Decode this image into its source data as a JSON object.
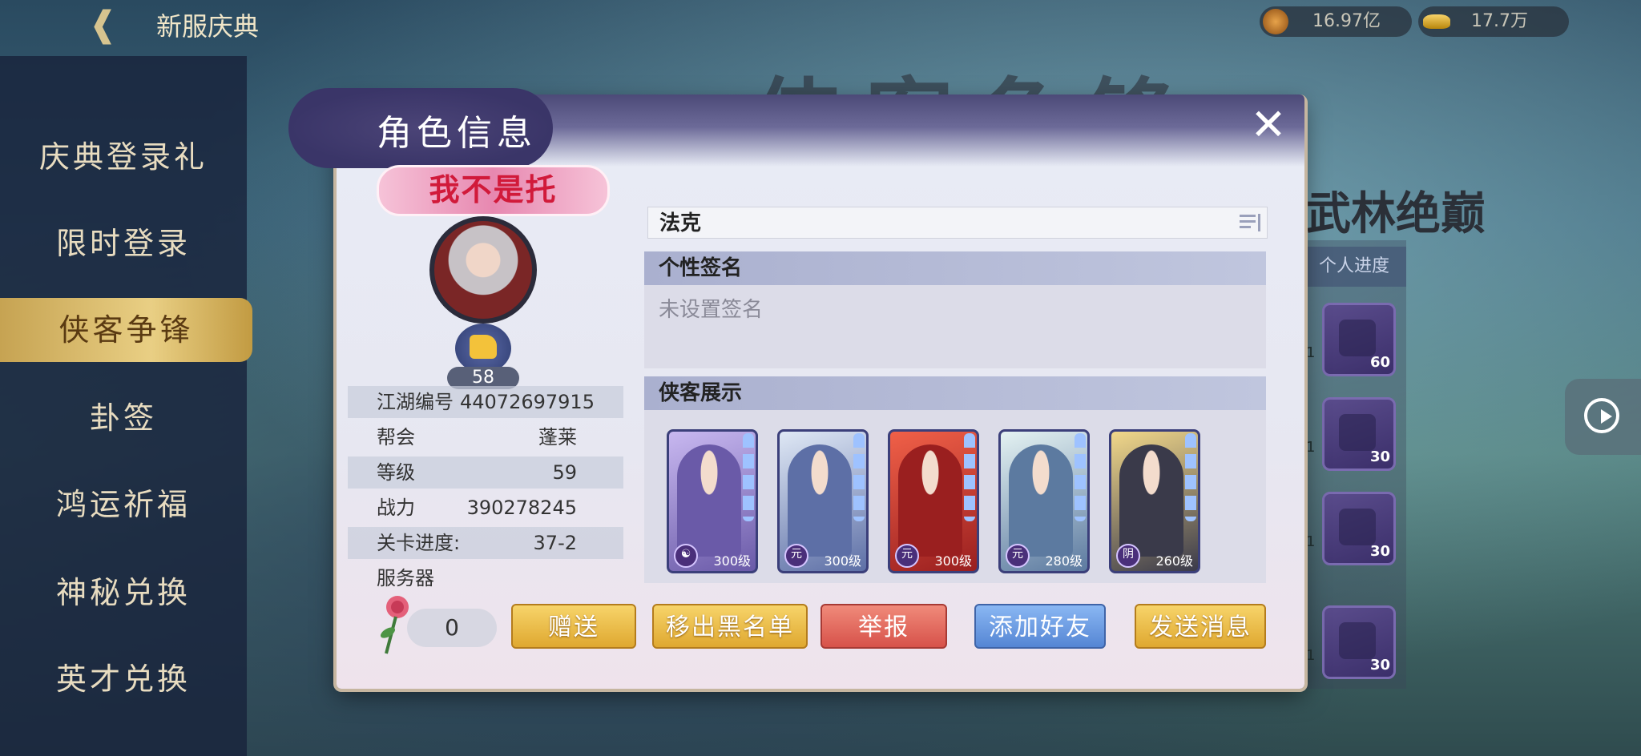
{
  "top_bar": {
    "back_icon": "back-arrow-icon",
    "title": "新服庆典",
    "resources": [
      {
        "icon": "coin-icon",
        "value": "16.97亿"
      },
      {
        "icon": "gold-ingot-icon",
        "value": "17.7万"
      }
    ]
  },
  "left_menu": {
    "items": [
      {
        "label": "庆典登录礼",
        "active": false
      },
      {
        "label": "限时登录",
        "active": false
      },
      {
        "label": "侠客争锋",
        "active": true
      },
      {
        "label": "卦签",
        "active": false
      },
      {
        "label": "鸿运祈福",
        "active": false
      },
      {
        "label": "神秘兑换",
        "active": false
      },
      {
        "label": "英才兑换",
        "active": false
      }
    ]
  },
  "background": {
    "subtitle": "武林绝巅",
    "panel_header": "个人进度",
    "rewards": [
      "60",
      "30",
      "30",
      "30"
    ],
    "reward_side_counts": [
      "1",
      "1",
      "1",
      "1"
    ]
  },
  "modal": {
    "title": "角色信息",
    "nickname_banner": "我不是托",
    "like_count": "58",
    "info": {
      "jianghu_id_label": "江湖编号",
      "jianghu_id_value": "44072697915",
      "guild_label": "帮会",
      "guild_value": "蓬莱",
      "level_label": "等级",
      "level_value": "59",
      "power_label": "战力",
      "power_value": "390278245",
      "stage_label": "关卡进度:",
      "stage_value": "37-2",
      "server_label": "服务器",
      "server_value": ""
    },
    "flower_count": "0",
    "player_name": "法克",
    "signature_header": "个性签名",
    "signature_text": "未设置签名",
    "heroes_header": "侠客展示",
    "heroes": [
      {
        "badge": "☯",
        "level": "300级",
        "colors": [
          "#c8b8f0",
          "#6a5aa8"
        ]
      },
      {
        "badge": "元",
        "level": "300级",
        "colors": [
          "#dfe8f5",
          "#5d6fa6"
        ]
      },
      {
        "badge": "元",
        "level": "300级",
        "colors": [
          "#f06048",
          "#9a1f1f"
        ]
      },
      {
        "badge": "元",
        "level": "280级",
        "colors": [
          "#e4f2f2",
          "#5c7aa0"
        ]
      },
      {
        "badge": "阴",
        "level": "260级",
        "colors": [
          "#f2d88a",
          "#3a3a4a"
        ]
      }
    ],
    "buttons": {
      "gift": "赠送",
      "remove_blacklist": "移出黑名单",
      "report": "举报",
      "add_friend": "添加好友",
      "send_message": "发送消息"
    }
  }
}
